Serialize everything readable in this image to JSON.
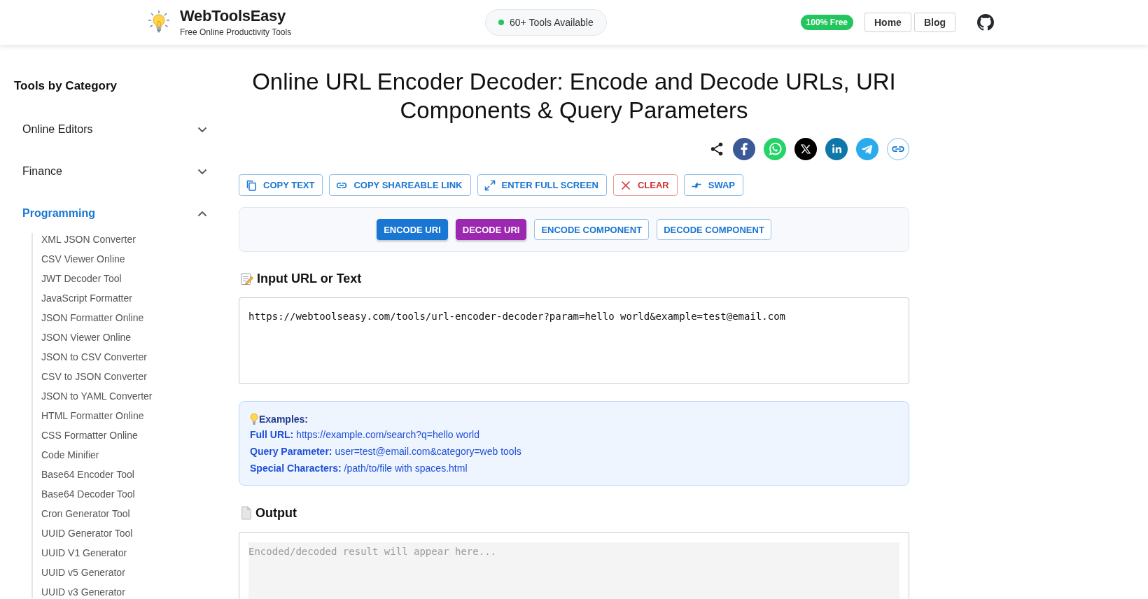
{
  "header": {
    "site_name": "WebToolsEasy",
    "tagline": "Free Online Productivity Tools",
    "tools_badge": "60+ Tools Available",
    "free_badge": "100% Free",
    "nav": [
      {
        "label": "Home"
      },
      {
        "label": "Blog"
      }
    ]
  },
  "sidebar": {
    "title": "Tools by Category",
    "categories": [
      {
        "label": "Online Editors",
        "expanded": false
      },
      {
        "label": "Finance",
        "expanded": false
      },
      {
        "label": "Programming",
        "expanded": true,
        "children": [
          {
            "label": "XML JSON Converter"
          },
          {
            "label": "CSV Viewer Online"
          },
          {
            "label": "JWT Decoder Tool"
          },
          {
            "label": "JavaScript Formatter"
          },
          {
            "label": "JSON Formatter Online"
          },
          {
            "label": "JSON Viewer Online"
          },
          {
            "label": "JSON to CSV Converter"
          },
          {
            "label": "CSV to JSON Converter"
          },
          {
            "label": "JSON to YAML Converter"
          },
          {
            "label": "HTML Formatter Online"
          },
          {
            "label": "CSS Formatter Online"
          },
          {
            "label": "Code Minifier"
          },
          {
            "label": "Base64 Encoder Tool"
          },
          {
            "label": "Base64 Decoder Tool"
          },
          {
            "label": "Cron Generator Tool"
          },
          {
            "label": "UUID Generator Tool"
          },
          {
            "label": "UUID V1 Generator"
          },
          {
            "label": "UUID v5 Generator"
          },
          {
            "label": "UUID v3 Generator"
          }
        ]
      }
    ]
  },
  "main": {
    "title": "Online URL Encoder Decoder: Encode and Decode URLs, URI Components & Query Parameters",
    "toolbar": [
      {
        "kind": "copy",
        "label": "COPY TEXT",
        "color": "#1976d2"
      },
      {
        "kind": "link",
        "label": "COPY SHAREABLE LINK",
        "color": "#1976d2"
      },
      {
        "kind": "fullscreen",
        "label": "ENTER FULL SCREEN",
        "color": "#1976d2"
      },
      {
        "kind": "clear",
        "label": "CLEAR",
        "color": "#d32f2f"
      },
      {
        "kind": "swap",
        "label": "SWAP",
        "color": "#1976d2"
      }
    ],
    "modes": [
      {
        "kind": "filled",
        "label": "ENCODE URI",
        "color": "#1976d2"
      },
      {
        "kind": "filled",
        "label": "DECODE URI",
        "color": "#9c27b0"
      },
      {
        "kind": "outlined",
        "label": "ENCODE COMPONENT",
        "color": "#1976d2"
      },
      {
        "kind": "outlined",
        "label": "DECODE COMPONENT",
        "color": "#1976d2"
      }
    ],
    "input": {
      "heading": "Input URL or Text",
      "value": "https://webtoolseasy.com/tools/url-encoder-decoder?param=hello world&example=test@email.com"
    },
    "examples": {
      "heading": "Examples:",
      "items": [
        "**Full URL:** https://example.com/search?q=hello world",
        "**Query Parameter:** user=test@email.com&category=web tools",
        "**Special Characters:** /path/to/file with spaces.html"
      ]
    },
    "output": {
      "heading": "Output",
      "placeholder": "Encoded/decoded result will appear here..."
    }
  }
}
